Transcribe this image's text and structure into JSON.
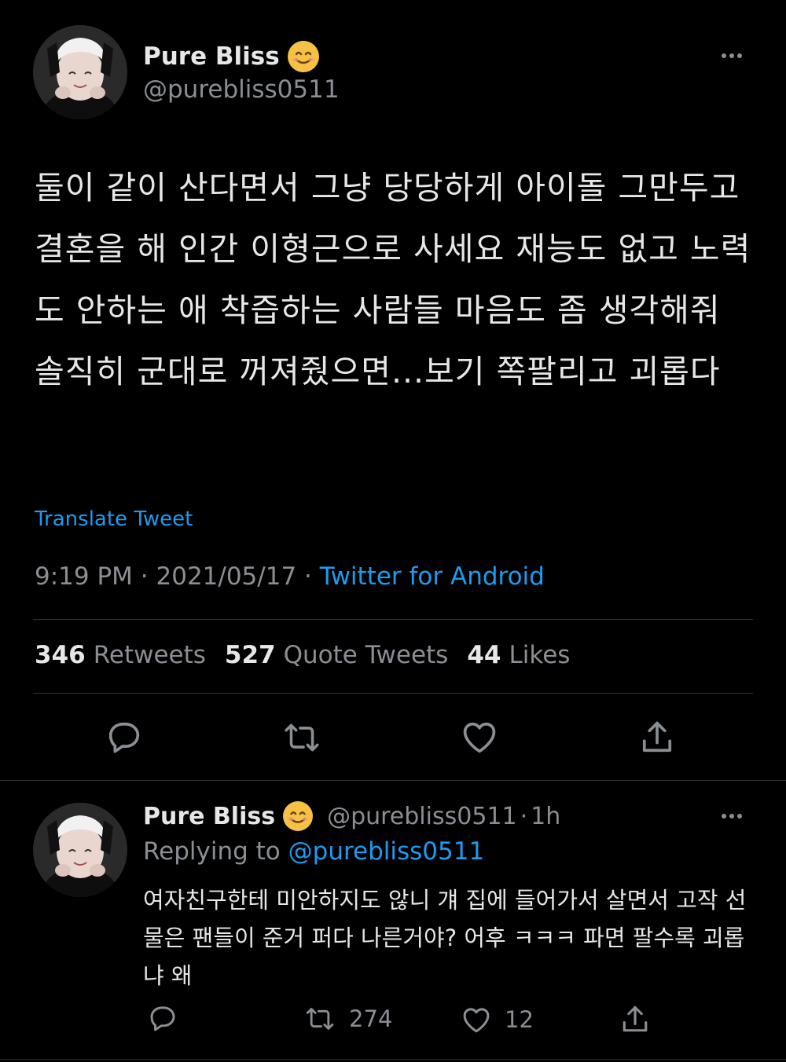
{
  "main_tweet": {
    "author_name": "Pure Bliss",
    "author_handle": "@purebliss0511",
    "text": "둘이 같이 산다면서 그냥 당당하게 아이돌 그만두고 결혼을 해 인간 이형근으로 사세요 재능도 없고 노력도 안하는 애 착즙하는 사람들 마음도 좀 생각해줘 솔직히 군대로 꺼져줬으면...보기 쪽팔리고 괴롭다",
    "translate_label": "Translate Tweet",
    "time": "9:19 PM",
    "date": "2021/05/17",
    "separator": "·",
    "source": "Twitter for Android",
    "stats": {
      "retweets_count": "346",
      "retweets_label": "Retweets",
      "quotes_count": "527",
      "quotes_label": "Quote Tweets",
      "likes_count": "44",
      "likes_label": "Likes"
    }
  },
  "reply_tweet": {
    "author_name": "Pure Bliss",
    "author_handle": "@purebliss0511",
    "time_ago": "1h",
    "replying_label": "Replying to",
    "replying_to": "@purebliss0511",
    "text": "여자친구한테 미안하지도 않니 걔 집에 들어가서 살면서 고작 선물은 팬들이 준거 퍼다 나른거야? 어후 ㅋㅋㅋ 파면 팔수록 괴롭냐 왜",
    "retweet_count": "274",
    "like_count": "12"
  },
  "icons": {
    "reply": "speech-bubble-icon",
    "retweet": "retweet-arrows-icon",
    "like": "heart-icon",
    "share": "share-upload-icon",
    "more": "more-dots-icon",
    "emoji": "smiling-face-emoji"
  },
  "colors": {
    "background": "#000000",
    "link": "#1d9bf0",
    "secondary_text": "#8b8f94",
    "divider": "#2f3336"
  }
}
